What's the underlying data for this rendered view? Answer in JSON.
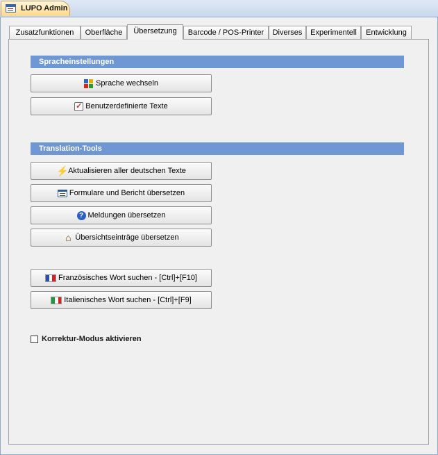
{
  "window": {
    "title": "LUPO Admin"
  },
  "tabs": [
    {
      "label": "Zusatzfunktionen",
      "active": false
    },
    {
      "label": "Oberfläche",
      "active": false
    },
    {
      "label": "Übersetzung",
      "active": true
    },
    {
      "label": "Barcode / POS-Printer",
      "active": false
    },
    {
      "label": "Diverses",
      "active": false
    },
    {
      "label": "Experimentell",
      "active": false
    },
    {
      "label": "Entwicklung",
      "active": false
    }
  ],
  "sections": {
    "spracheinstellungen": {
      "title": "Spracheinstellungen",
      "buttons": {
        "sprache_wechseln": {
          "label": "Sprache wechseln",
          "icon": "language-flags-icon"
        },
        "benutzerdefinierte_texte": {
          "label": "Benutzerdefinierte Texte",
          "icon": "checklist-icon"
        }
      }
    },
    "translation_tools": {
      "title": "Translation-Tools",
      "buttons": {
        "aktualisieren": {
          "label": "Aktualisieren aller deutschen Texte",
          "icon": "lightning-icon"
        },
        "formulare": {
          "label": "Formulare und Bericht übersetzen",
          "icon": "form-icon"
        },
        "meldungen": {
          "label": "Meldungen übersetzen",
          "icon": "help-icon"
        },
        "uebersicht": {
          "label": "Übersichtseinträge übersetzen",
          "icon": "home-icon"
        }
      }
    },
    "search": {
      "franzoesisch": {
        "label": "Französisches Wort suchen - [Ctrl]+[F10]",
        "icon": "flag-france-icon"
      },
      "italienisch": {
        "label": "Italienisches Wort suchen - [Ctrl]+[F9]",
        "icon": "flag-italy-icon"
      }
    }
  },
  "options": {
    "korrektur_modus": {
      "label": "Korrektur-Modus aktivieren",
      "checked": false
    }
  },
  "colors": {
    "section_header": "#6f97d3",
    "doc_tab": "#ffd98a",
    "window_frame": "#8fa7c8"
  }
}
